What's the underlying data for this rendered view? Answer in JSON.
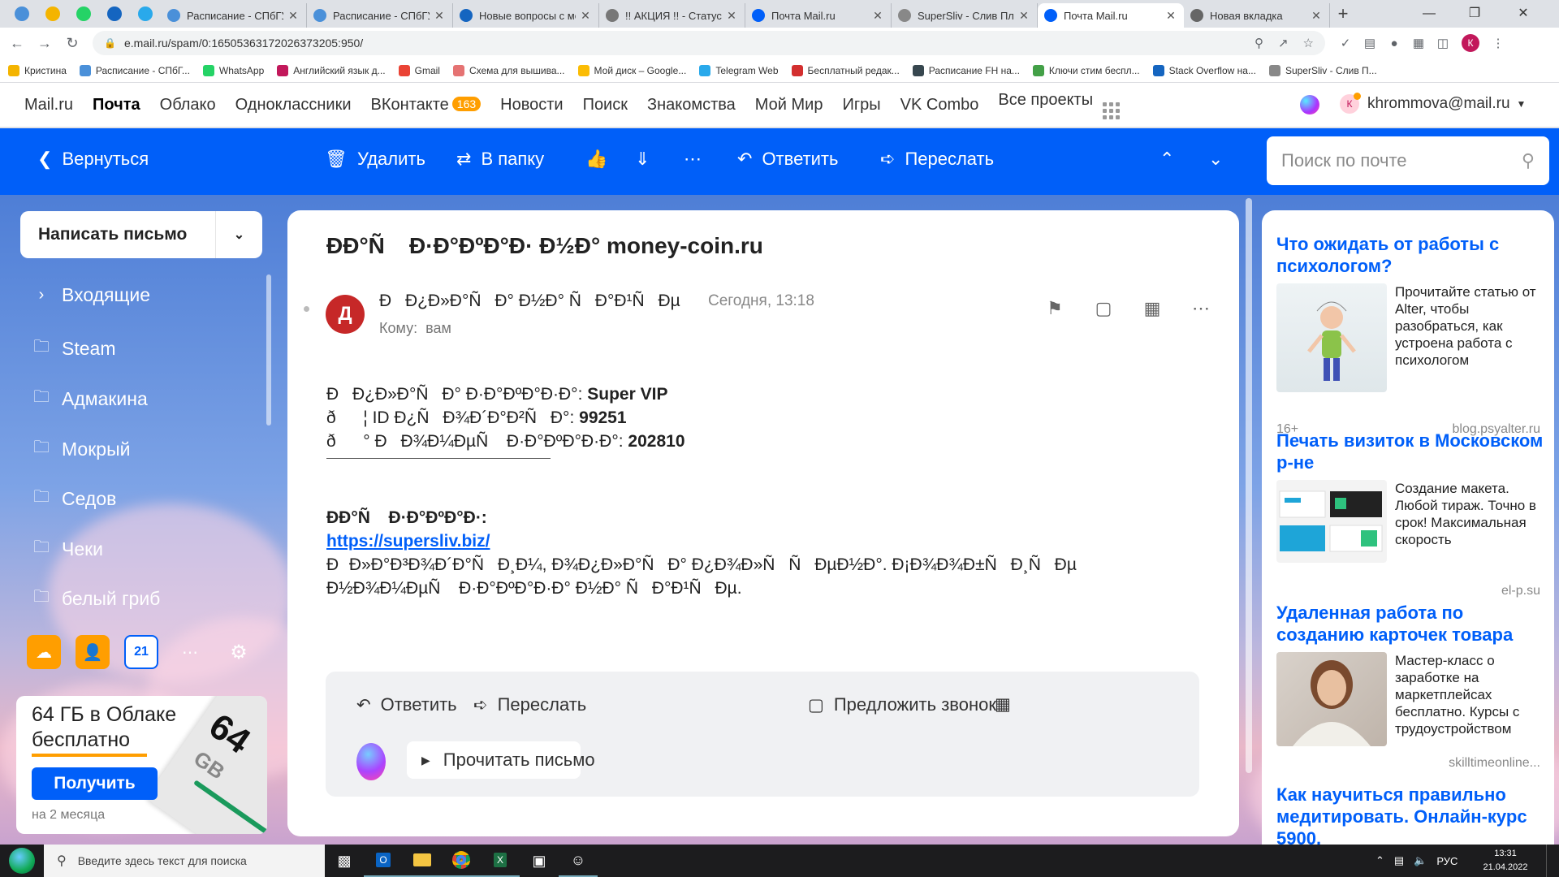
{
  "browser": {
    "pinned_tabs": [
      {
        "name": "tab-pinned-1",
        "color": "#4a90d9"
      },
      {
        "name": "tab-pinned-2",
        "color": "#f4b400"
      },
      {
        "name": "tab-pinned-3",
        "color": "#25d366"
      },
      {
        "name": "tab-pinned-4",
        "color": "#1565c0"
      },
      {
        "name": "tab-pinned-5",
        "color": "#29a9eb"
      }
    ],
    "tabs": [
      {
        "title": "Расписание - СПбГУП",
        "color": "#4a90d9"
      },
      {
        "title": "Расписание - СПбГУП",
        "color": "#4a90d9"
      },
      {
        "title": "Новые вопросы с ме",
        "color": "#1565c0"
      },
      {
        "title": "!! АКЦИЯ !! - Статус S",
        "color": "#777777"
      },
      {
        "title": "Почта Mail.ru",
        "color": "#005ff9"
      },
      {
        "title": "SuperSliv - Слив Плат",
        "color": "#888888"
      },
      {
        "title": "Почта Mail.ru",
        "color": "#005ff9",
        "active": true
      },
      {
        "title": "Новая вкладка",
        "color": "#666666"
      }
    ],
    "new_tab_label": "+",
    "url": "e.mail.ru/spam/0:16505363172026373205:950/",
    "profile_initial": "К",
    "bookmarks": [
      {
        "label": "Кристина",
        "color": "#f4b400"
      },
      {
        "label": "Расписание - СПбГ...",
        "color": "#4a90d9"
      },
      {
        "label": "WhatsApp",
        "color": "#25d366"
      },
      {
        "label": "Английский язык д...",
        "color": "#c2185b"
      },
      {
        "label": "Gmail",
        "color": "#ea4335"
      },
      {
        "label": "Схема для вышива...",
        "color": "#e57373"
      },
      {
        "label": "Мой диск – Google...",
        "color": "#fbbc04"
      },
      {
        "label": "Telegram Web",
        "color": "#29a9eb"
      },
      {
        "label": "Бесплатный редак...",
        "color": "#d32f2f"
      },
      {
        "label": "Расписание FH на...",
        "color": "#37474f"
      },
      {
        "label": "Ключи стим беспл...",
        "color": "#43a047"
      },
      {
        "label": "Stack Overflow на...",
        "color": "#1565c0"
      },
      {
        "label": "SuperSliv - Слив П...",
        "color": "#888888"
      }
    ]
  },
  "portal": {
    "items": [
      "Mail.ru",
      "Почта",
      "Облако",
      "Одноклассники",
      "ВКонтакте",
      "Новости",
      "Поиск",
      "Знакомства",
      "Мой Мир",
      "Игры",
      "VK Combo",
      "Все проекты"
    ],
    "vk_badge": "163",
    "user_initial": "К",
    "user_email": "khrommova@mail.ru"
  },
  "toolbar": {
    "back": "Вернуться",
    "delete": "Удалить",
    "to_folder": "В папку",
    "reply": "Ответить",
    "forward": "Переслать",
    "search_placeholder": "Поиск по почте"
  },
  "sidebar": {
    "compose": "Написать письмо",
    "folders": [
      "Входящие",
      "Steam",
      "Адмакина",
      "Мокрый",
      "Седов",
      "Чеки",
      "белый гриб"
    ],
    "calendar_day": "21",
    "promo": {
      "title": "64 ГБ в Облаке бесплатно",
      "button": "Получить",
      "sub": "на 2 месяца",
      "card_big": "64",
      "card_unit": "GB"
    }
  },
  "email": {
    "subject": "Ð­Ð°Ñ Ð·Ð°ÐºÐ°Ð· Ð½Ð° money-coin.ru",
    "avatar_letter": "Д",
    "sender": "ÐÐ¿Ð»Ð°ÑÐ° Ð½Ð° ÑÐ°Ð¹ÑÐµ",
    "time": "Сегодня, 13:18",
    "to_label": "Кому:",
    "to_value": "вам",
    "lines": [
      {
        "label": "ÐÐ¿Ð»Ð°ÑÐ° Ð·Ð°ÐºÐ°Ð·Ð°:",
        "value": "Super VIP"
      },
      {
        "label": "ð¦ ID Ð¿ÑÐ¾Ð´Ð°Ð²ÑÐ°:",
        "value": "99251"
      },
      {
        "label": "ð° ÐÐ¾Ð¼ÐµÑ Ð·Ð°ÐºÐ°Ð·Ð°:",
        "value": "202810"
      }
    ],
    "section_title": "Ð­Ð°Ñ Ð·Ð°ÐºÐ°Ð·:",
    "link": "https://supersliv.biz/",
    "paragraph": "ÐÐ»Ð°Ð³Ð¾Ð´Ð°ÑÐ¸Ð¼, Ð¾Ð¿Ð»Ð°ÑÐ° Ð¿Ð¾Ð»ÑÑÐµÐ½Ð°. Ð¡Ð¾Ð¾Ð±ÑÐ¸ÑÐµ Ð½Ð¾Ð¼ÐµÑ Ð·Ð°ÐºÐ°Ð·Ð° Ð½Ð° ÑÐ°Ð¹ÑÐµ.",
    "reply": "Ответить",
    "forward": "Переслать",
    "propose_call": "Предложить звонок",
    "read_aloud": "Прочитать письмо"
  },
  "ads": [
    {
      "title": "Что ожидать от работы с психологом?",
      "text": "Прочитайте статью от Alter, чтобы разобраться, как устроена работа с психологом",
      "age": "16+",
      "domain": "blog.psyalter.ru"
    },
    {
      "title": "Печать визиток в Московском р-не",
      "text": "Создание макета. Любой тираж. Точно в срок! Максимальная скорость",
      "age": "",
      "domain": "el-p.su"
    },
    {
      "title": "Удаленная работа по созданию карточек товара",
      "text": "Мастер-класс о заработке на маркетплейсах бесплатно. Курсы с трудоустройством",
      "age": "",
      "domain": "skilltimeonline..."
    },
    {
      "title": "Как научиться правильно медитировать. Онлайн-курс 5900.",
      "text": "",
      "age": "",
      "domain": ""
    }
  ],
  "taskbar": {
    "search_placeholder": "Введите здесь текст для поиска",
    "lang": "РУС",
    "time": "13:31",
    "date": "21.04.2022"
  }
}
